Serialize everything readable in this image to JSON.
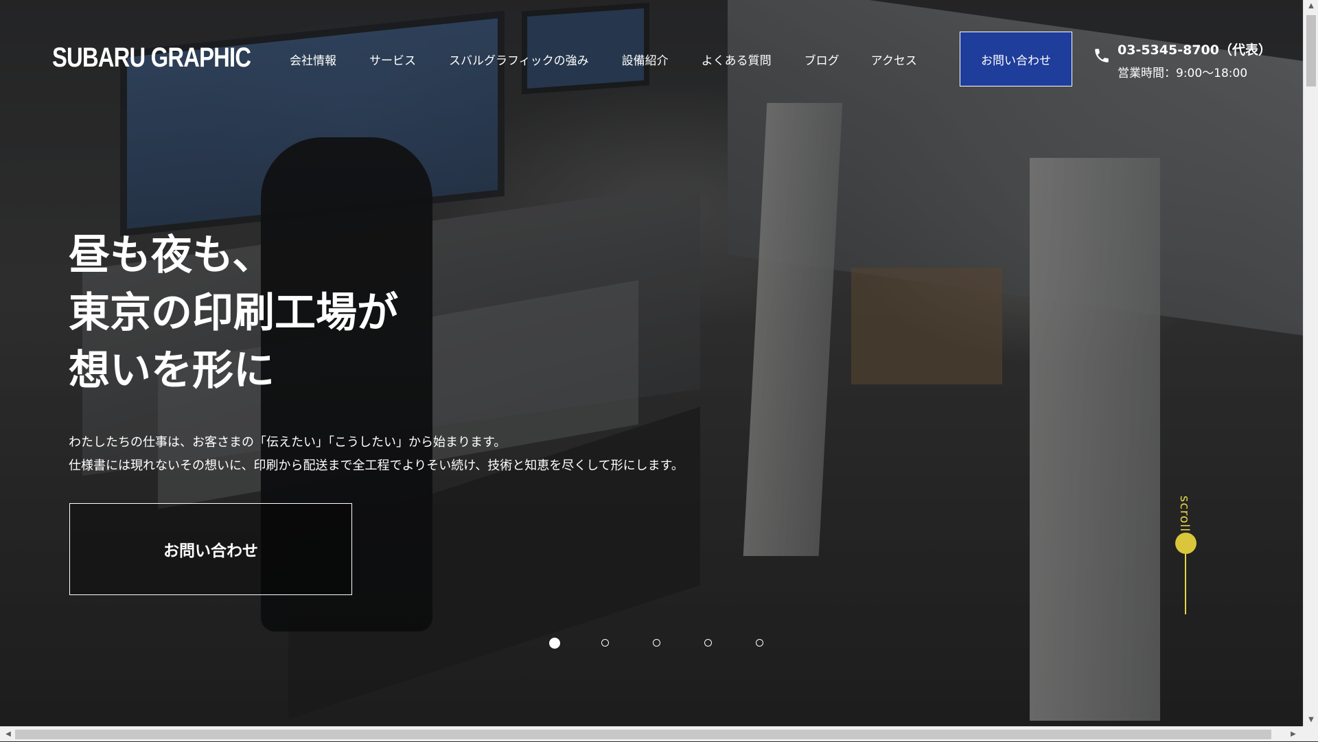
{
  "header": {
    "logo": "SUBARU GRAPHIC",
    "nav": [
      "会社情報",
      "サービス",
      "スバルグラフィックの強み",
      "設備紹介",
      "よくある質問",
      "ブログ",
      "アクセス"
    ],
    "contact_button": "お問い合わせ",
    "phone": "03-5345-8700（代表）",
    "hours": "営業時間：9:00〜18:00"
  },
  "hero": {
    "headline": [
      "昼も夜も、",
      "東京の印刷工場が",
      "想いを形に"
    ],
    "lead": [
      "わたしたちの仕事は、お客さまの「伝えたい」「こうしたい」から始まります。",
      "仕様書には現れないその想いに、印刷から配送まで全工程でよりそい続け、技術と知恵を尽くして形にします。"
    ],
    "cta": "お問い合わせ"
  },
  "slider": {
    "total": 5,
    "active": 1
  },
  "scroll_label": "scroll",
  "colors": {
    "accent": "#1f3d9a",
    "scroll": "#e5d54a"
  }
}
